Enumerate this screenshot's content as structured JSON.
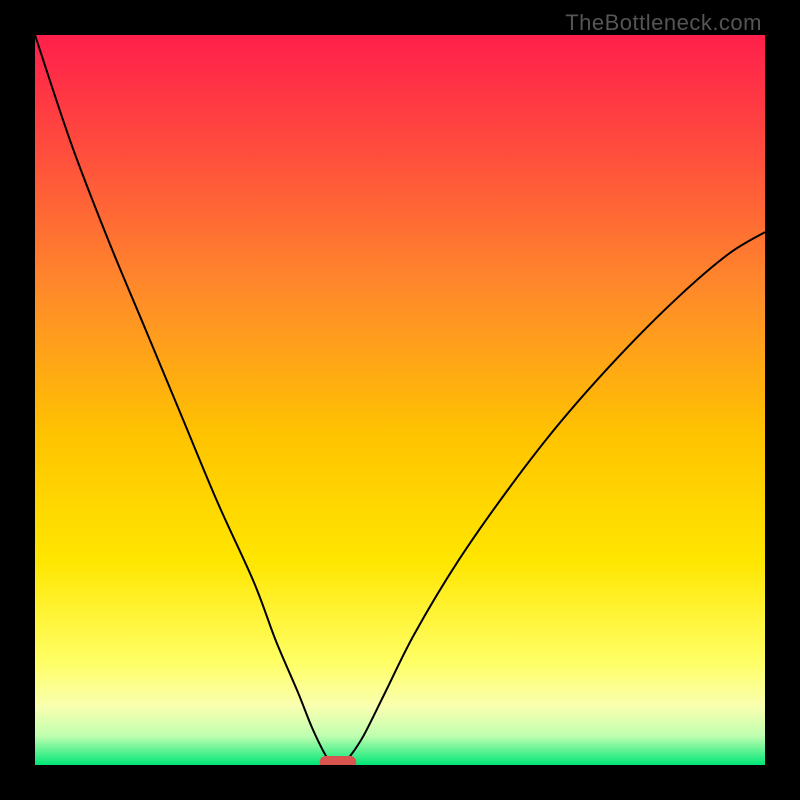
{
  "watermark": "TheBottleneck.com",
  "chart_data": {
    "type": "line",
    "title": "",
    "xlabel": "",
    "ylabel": "",
    "xlim": [
      0,
      100
    ],
    "ylim": [
      0,
      100
    ],
    "gradient_stops": [
      {
        "pos": 0,
        "color": "#ff1f4b"
      },
      {
        "pos": 0.15,
        "color": "#ff4a3e"
      },
      {
        "pos": 0.35,
        "color": "#ff8a2a"
      },
      {
        "pos": 0.55,
        "color": "#ffc400"
      },
      {
        "pos": 0.72,
        "color": "#ffe600"
      },
      {
        "pos": 0.86,
        "color": "#ffff66"
      },
      {
        "pos": 0.92,
        "color": "#f9ffb0"
      },
      {
        "pos": 0.96,
        "color": "#c0ffb0"
      },
      {
        "pos": 1.0,
        "color": "#00e676"
      }
    ],
    "series": [
      {
        "name": "bottleneck-curve",
        "x": [
          0,
          5,
          10,
          15,
          20,
          25,
          30,
          33,
          36,
          38,
          40,
          41,
          42,
          43,
          45,
          48,
          52,
          58,
          65,
          72,
          80,
          88,
          95,
          100
        ],
        "y": [
          100,
          85,
          72,
          60,
          48,
          36,
          25,
          17,
          10,
          5,
          1,
          0,
          0,
          1,
          4,
          10,
          18,
          28,
          38,
          47,
          56,
          64,
          70,
          73
        ]
      }
    ],
    "marker": {
      "x": 41.5,
      "y": 0,
      "width": 5,
      "color": "#d9534f"
    }
  }
}
